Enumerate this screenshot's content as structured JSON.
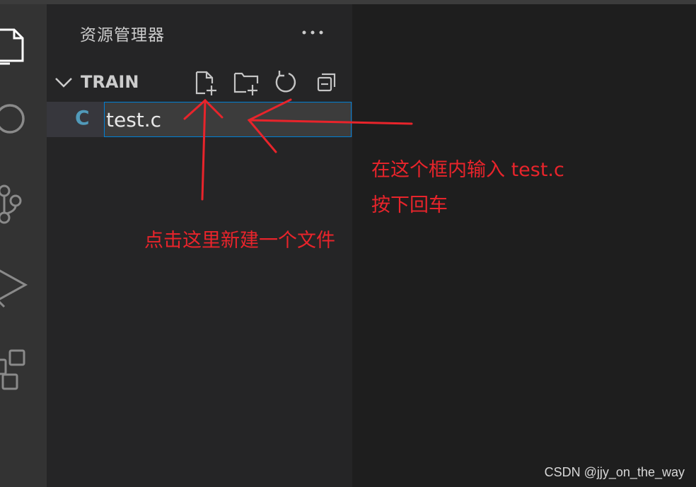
{
  "sidebar": {
    "title": "资源管理器",
    "section_title": "TRAIN",
    "toolbar": {
      "new_file_icon": "new-file-icon",
      "new_folder_icon": "new-folder-icon",
      "refresh_icon": "refresh-icon",
      "collapse_icon": "collapse-all-icon"
    },
    "file": {
      "language_glyph": "C",
      "rename_value": "test.c"
    }
  },
  "activity_bar": {
    "items": [
      "explorer-icon",
      "search-icon",
      "source-control-icon",
      "run-debug-icon",
      "extensions-icon"
    ]
  },
  "annotations": {
    "input_hint_line1": "在这个框内输入 test.c",
    "input_hint_line2": "按下回车",
    "new_file_hint": "点击这里新建一个文件"
  },
  "watermark": "CSDN @jjy_on_the_way",
  "colors": {
    "annotation": "#e8242b",
    "focus_border": "#007fd4",
    "c_icon": "#519aba"
  }
}
